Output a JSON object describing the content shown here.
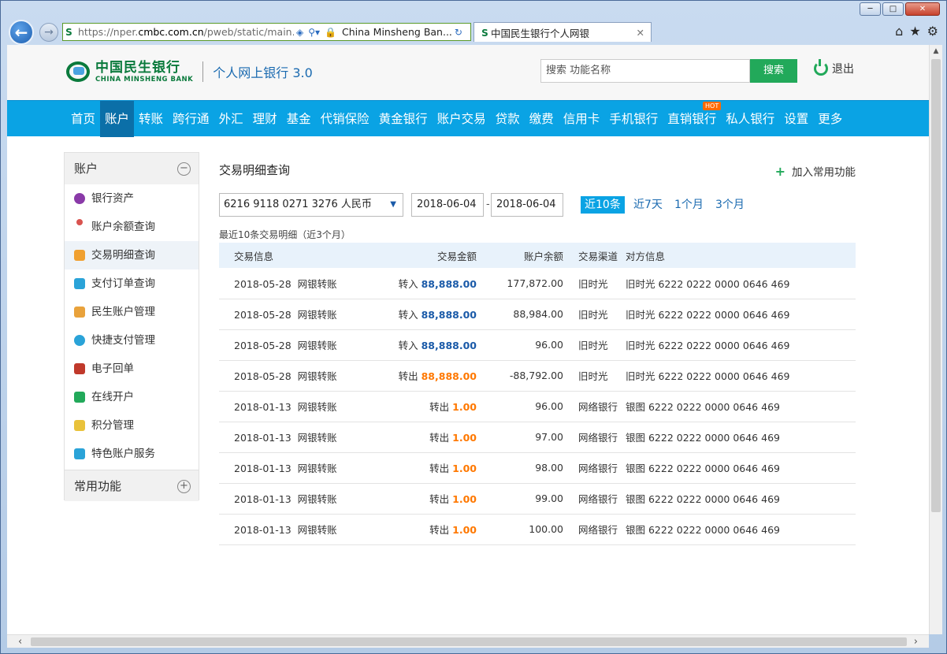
{
  "browser": {
    "url_prefix": "https://nper.",
    "url_domain": "cmbc.com.cn",
    "url_suffix": "/pweb/static/main.ht",
    "site_name": "China Minsheng Ban...",
    "tab_title": "中国民生银行个人网银"
  },
  "header": {
    "logo_cn": "中国民生银行",
    "logo_en": "CHINA MINSHENG BANK",
    "product": "个人网上银行 3.0",
    "search_placeholder": "搜索 功能名称",
    "search_button": "搜索",
    "logout": "退出"
  },
  "nav": {
    "items": [
      "首页",
      "账户",
      "转账",
      "跨行通",
      "外汇",
      "理财",
      "基金",
      "代销保险",
      "黄金银行",
      "账户交易",
      "贷款",
      "缴费",
      "信用卡",
      "手机银行",
      "直销银行",
      "私人银行",
      "设置",
      "更多"
    ],
    "hot_badge": "HOT"
  },
  "sidebar": {
    "section": "账户",
    "items": [
      "银行资产",
      "账户余额查询",
      "交易明细查询",
      "支付订单查询",
      "民生账户管理",
      "快捷支付管理",
      "电子回单",
      "在线开户",
      "积分管理",
      "特色账户服务"
    ],
    "footer": "常用功能",
    "toggle_minus": "−",
    "toggle_plus": "+"
  },
  "content": {
    "title": "交易明细查询",
    "add_favorite": "加入常用功能",
    "account_select": "6216 9118 0271 3276 人民币",
    "date_from": "2018-06-04",
    "date_to": "2018-06-04",
    "date_sep": "-",
    "ranges": [
      "近10条",
      "近7天",
      "1个月",
      "3个月"
    ],
    "subtitle": "最近10条交易明细（近3个月）",
    "columns": [
      "交易信息",
      "交易金额",
      "账户余额",
      "交易渠道",
      "对方信息"
    ],
    "rows": [
      {
        "date": "2018-05-28",
        "type": "网银转账",
        "dir": "转入",
        "amount": "88,888.00",
        "balance": "177,872.00",
        "channel": "旧时光",
        "party": "旧时光 6222 0222 0000 0646 469"
      },
      {
        "date": "2018-05-28",
        "type": "网银转账",
        "dir": "转入",
        "amount": "88,888.00",
        "balance": "88,984.00",
        "channel": "旧时光",
        "party": "旧时光 6222 0222 0000 0646 469"
      },
      {
        "date": "2018-05-28",
        "type": "网银转账",
        "dir": "转入",
        "amount": "88,888.00",
        "balance": "96.00",
        "channel": "旧时光",
        "party": "旧时光 6222 0222 0000 0646 469"
      },
      {
        "date": "2018-05-28",
        "type": "网银转账",
        "dir": "转出",
        "amount": "88,888.00",
        "balance": "-88,792.00",
        "channel": "旧时光",
        "party": "旧时光 6222 0222 0000 0646 469"
      },
      {
        "date": "2018-01-13",
        "type": "网银转账",
        "dir": "转出",
        "amount": "1.00",
        "balance": "96.00",
        "channel": "网络银行",
        "party": "银图 6222 0222 0000 0646 469"
      },
      {
        "date": "2018-01-13",
        "type": "网银转账",
        "dir": "转出",
        "amount": "1.00",
        "balance": "97.00",
        "channel": "网络银行",
        "party": "银图 6222 0222 0000 0646 469"
      },
      {
        "date": "2018-01-13",
        "type": "网银转账",
        "dir": "转出",
        "amount": "1.00",
        "balance": "98.00",
        "channel": "网络银行",
        "party": "银图 6222 0222 0000 0646 469"
      },
      {
        "date": "2018-01-13",
        "type": "网银转账",
        "dir": "转出",
        "amount": "1.00",
        "balance": "99.00",
        "channel": "网络银行",
        "party": "银图 6222 0222 0000 0646 469"
      },
      {
        "date": "2018-01-13",
        "type": "网银转账",
        "dir": "转出",
        "amount": "1.00",
        "balance": "100.00",
        "channel": "网络银行",
        "party": "银图 6222 0222 0000 0646 469"
      }
    ]
  },
  "colors": {
    "brand_green": "#0a7a3c",
    "nav_blue": "#0aa3e4",
    "amount_in": "#1a5aa8",
    "amount_out": "#ff7800",
    "button_green": "#22a95a"
  },
  "icons": [
    "back-arrow-icon",
    "forward-arrow-icon",
    "lock-icon",
    "search-icon",
    "home-icon",
    "star-icon",
    "gear-icon",
    "power-icon",
    "plus-icon"
  ]
}
